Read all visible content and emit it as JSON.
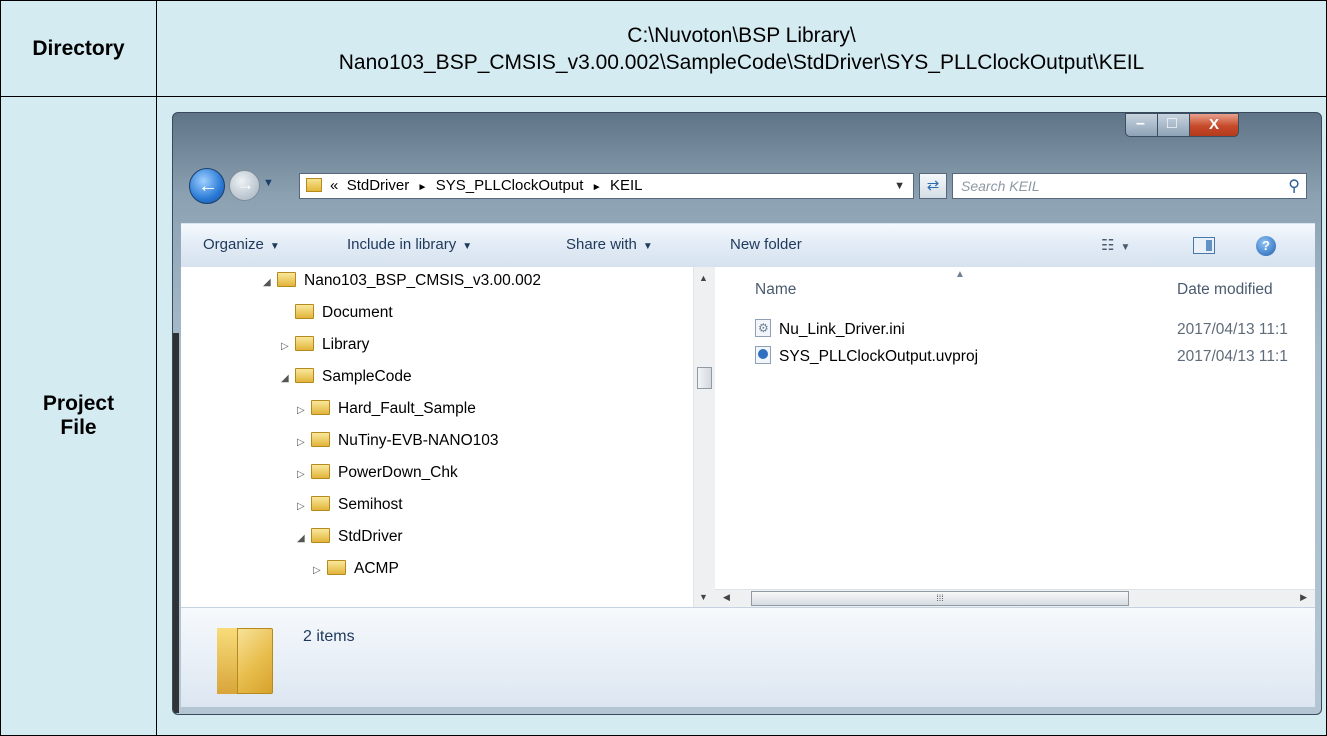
{
  "table": {
    "directory_header": "Directory",
    "directory_path_line1": "C:\\Nuvoton\\BSP Library\\",
    "directory_path_line2": "Nano103_BSP_CMSIS_v3.00.002\\SampleCode\\StdDriver\\SYS_PLLClockOutput\\KEIL",
    "project_header_line1": "Project",
    "project_header_line2": "File"
  },
  "explorer": {
    "window_controls": {
      "minimize": "–",
      "maximize": "□",
      "close": "X"
    },
    "address": {
      "overflow": "«",
      "crumb1": "StdDriver",
      "crumb2": "SYS_PLLClockOutput",
      "crumb3": "KEIL",
      "separator": "►"
    },
    "search_placeholder": "Search KEIL",
    "toolbar": {
      "organize": "Organize",
      "include_in_library": "Include in library",
      "share_with": "Share with",
      "new_folder": "New folder"
    },
    "tree": [
      {
        "label": "Nano103_BSP_CMSIS_v3.00.002",
        "expander": "◢"
      },
      {
        "label": "Document",
        "expander": ""
      },
      {
        "label": "Library",
        "expander": "▷"
      },
      {
        "label": "SampleCode",
        "expander": "◢"
      },
      {
        "label": "Hard_Fault_Sample",
        "expander": "▷"
      },
      {
        "label": "NuTiny-EVB-NANO103",
        "expander": "▷"
      },
      {
        "label": "PowerDown_Chk",
        "expander": "▷"
      },
      {
        "label": "Semihost",
        "expander": "▷"
      },
      {
        "label": "StdDriver",
        "expander": "◢"
      },
      {
        "label": "ACMP",
        "expander": "▷"
      }
    ],
    "columns": {
      "name": "Name",
      "date_modified": "Date modified"
    },
    "files": [
      {
        "name": "Nu_Link_Driver.ini",
        "date": "2017/04/13 11:1",
        "icon": "settings-file-icon"
      },
      {
        "name": "SYS_PLLClockOutput.uvproj",
        "date": "2017/04/13 11:1",
        "icon": "keil-project-icon"
      }
    ],
    "status": {
      "item_count": "2 items"
    }
  }
}
